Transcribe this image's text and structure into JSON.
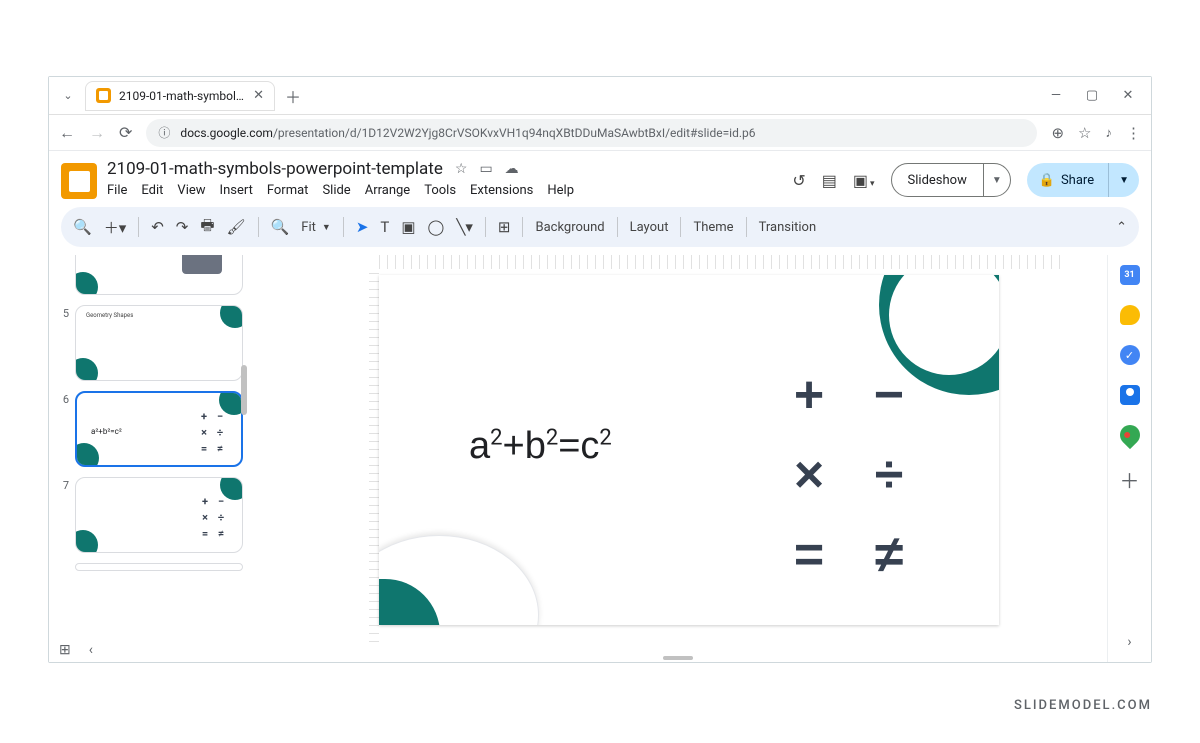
{
  "browser": {
    "tab_title": "2109-01-math-symbols-powerp",
    "url_host": "docs.google.com",
    "url_path": "/presentation/d/1D12V2W2Yjg8CrVSOKvxVH1q94nqXBtDDuMaSAwbtBxI/edit#slide=id.p6"
  },
  "doc": {
    "title": "2109-01-math-symbols-powerpoint-template",
    "menus": [
      "File",
      "Edit",
      "View",
      "Insert",
      "Format",
      "Slide",
      "Arrange",
      "Tools",
      "Extensions",
      "Help"
    ]
  },
  "actions": {
    "slideshow": "Slideshow",
    "share": "Share"
  },
  "toolbar": {
    "zoom_label": "Fit",
    "background": "Background",
    "layout": "Layout",
    "theme": "Theme",
    "transition": "Transition"
  },
  "thumbs": {
    "n5": "5",
    "n6": "6",
    "n7": "7",
    "t5_title": "Geometry Shapes",
    "eq_small": "a²+b²=c²"
  },
  "slide": {
    "equation_html": "a<sup>2</sup>+b<sup>2</sup>=c<sup>2</sup>",
    "symbols": {
      "plus": "+",
      "minus": "−",
      "times": "×",
      "divide": "÷",
      "equals": "=",
      "neq": "≠"
    }
  },
  "watermark": "SLIDEMODEL.COM"
}
